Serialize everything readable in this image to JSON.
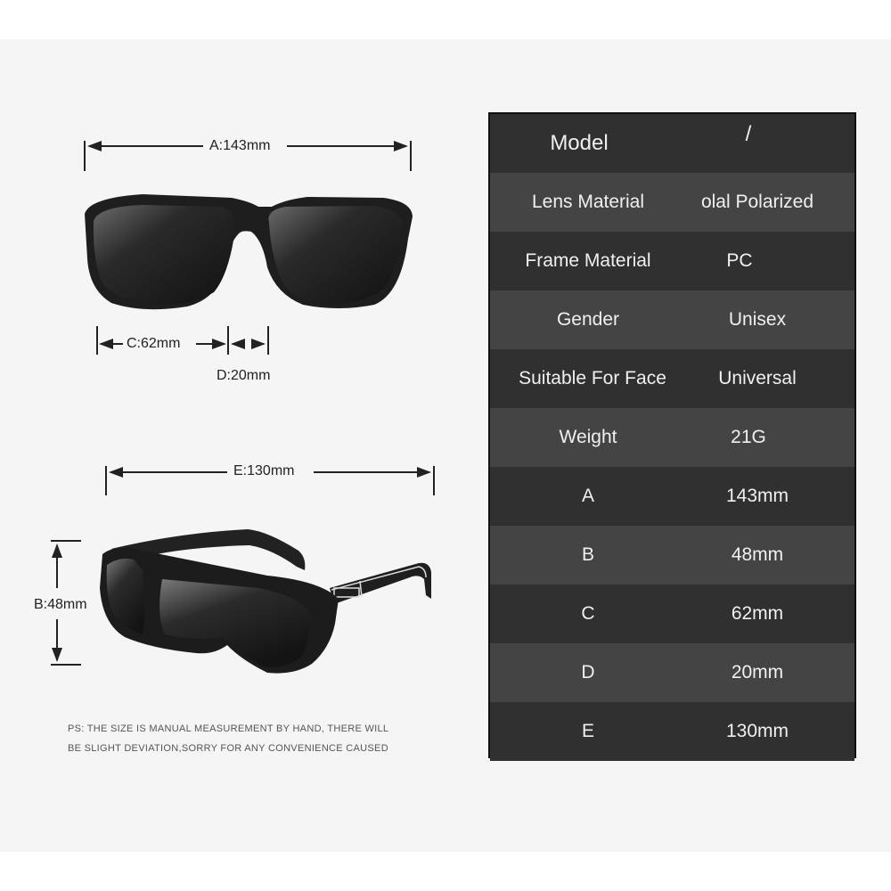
{
  "diagram": {
    "front_view": {
      "width_label": "A:143mm",
      "lens_label": "C:62mm",
      "bridge_label": "D:20mm"
    },
    "side_view": {
      "temple_label": "E:130mm",
      "height_label": "B:48mm"
    },
    "note_lines": [
      "PS: THE SIZE IS MANUAL MEASUREMENT BY HAND, THERE WILL",
      "BE SLIGHT DEVIATION,SORRY FOR ANY CONVENIENCE CAUSED"
    ]
  },
  "spec_table": {
    "rows": [
      {
        "key": "Model",
        "value": "/"
      },
      {
        "key": "Lens Material",
        "value": "olal Polarized"
      },
      {
        "key": "Frame Material",
        "value": "PC"
      },
      {
        "key": "Gender",
        "value": "Unisex"
      },
      {
        "key": "Suitable For Face",
        "value": "Universal"
      },
      {
        "key": "Weight",
        "value": "21G"
      },
      {
        "key": "A",
        "value": "143mm"
      },
      {
        "key": "B",
        "value": "48mm"
      },
      {
        "key": "C",
        "value": "62mm"
      },
      {
        "key": "D",
        "value": "20mm"
      },
      {
        "key": "E",
        "value": "130mm"
      }
    ]
  },
  "colors": {
    "table_dark": "#303030",
    "table_light": "#444444",
    "background": "#f5f5f5"
  }
}
